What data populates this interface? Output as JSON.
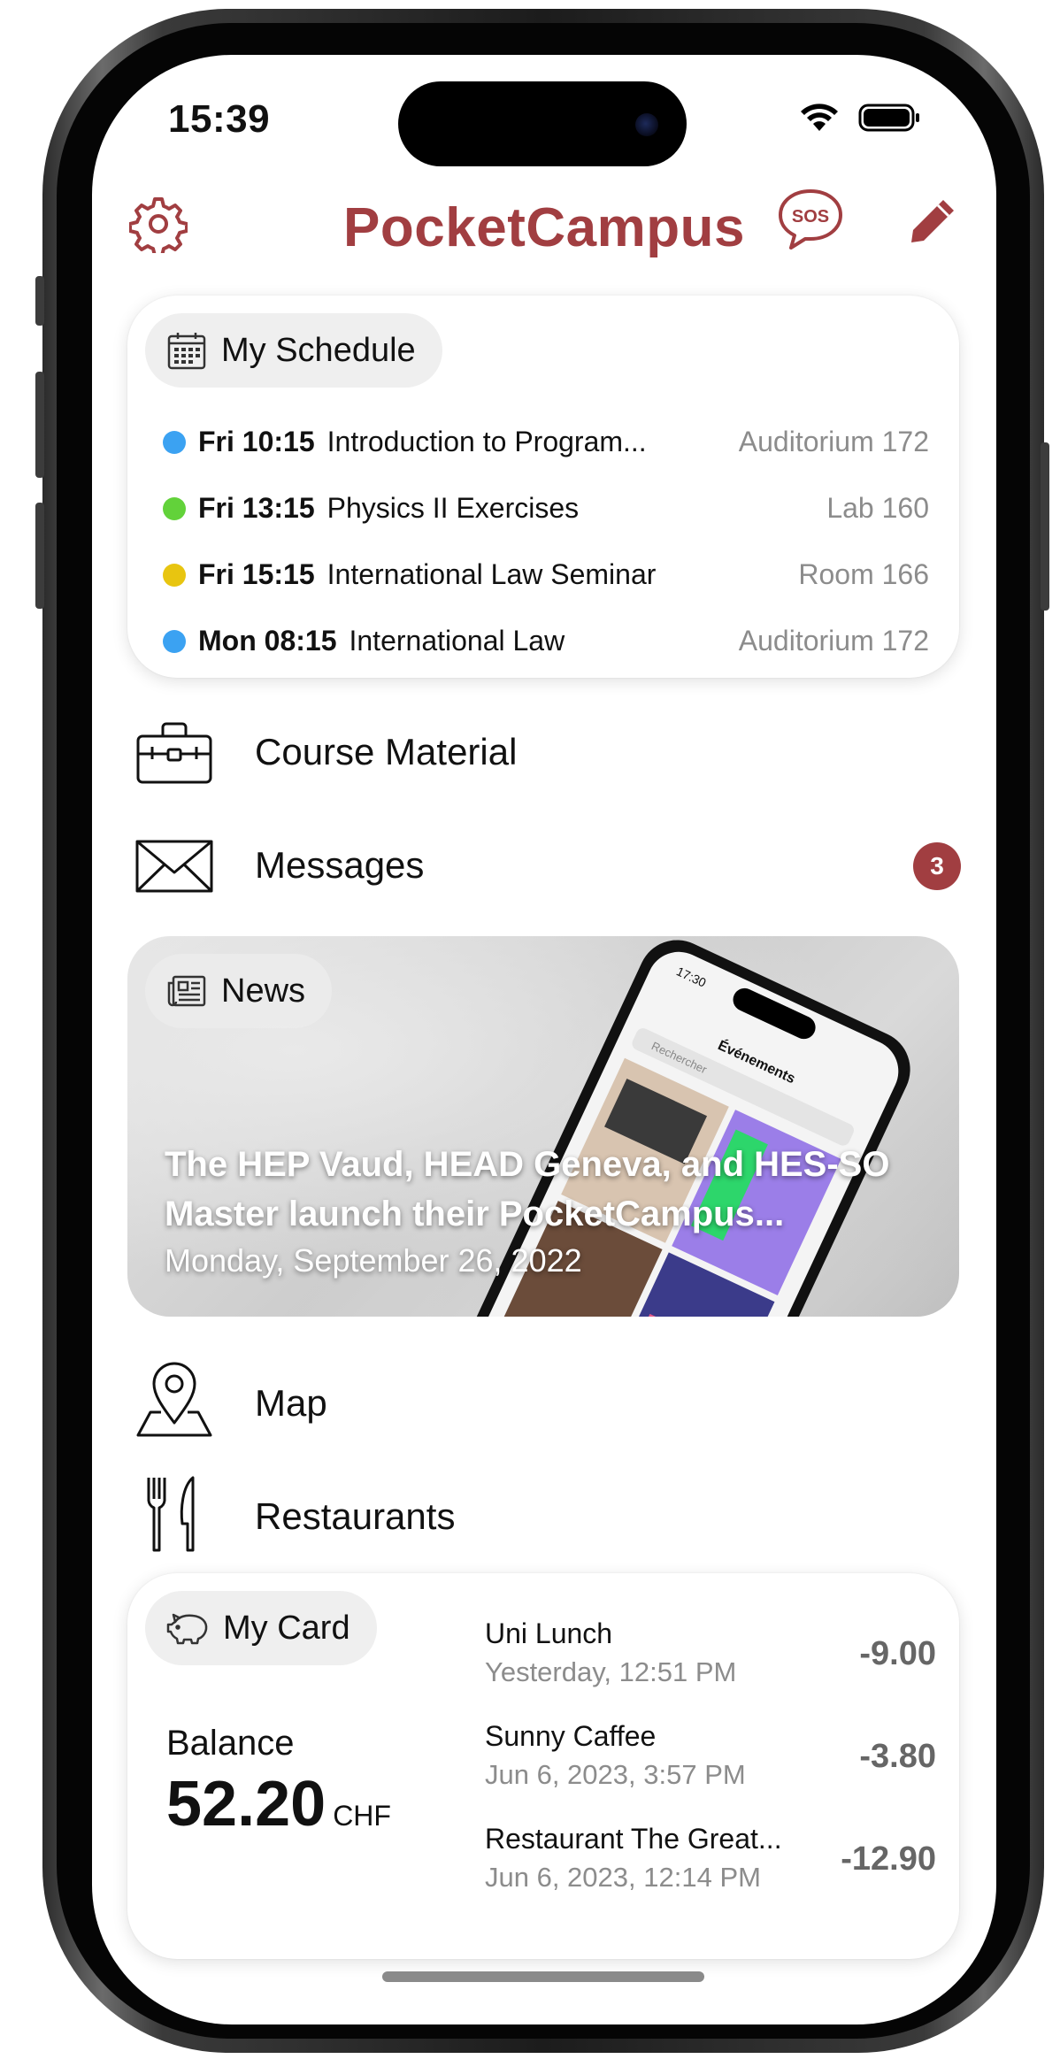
{
  "status_bar": {
    "time": "15:39"
  },
  "header": {
    "title": "PocketCampus",
    "settings_icon": "gear-icon",
    "sos_icon": "sos-icon",
    "sos_label": "SOS",
    "edit_icon": "pencil-icon"
  },
  "schedule": {
    "label": "My Schedule",
    "icon": "calendar-icon",
    "events": [
      {
        "time": "Fri 10:15",
        "title": "Introduction to Program...",
        "room": "Auditorium 172",
        "color": "#3ba2f2"
      },
      {
        "time": "Fri 13:15",
        "title": "Physics II Exercises",
        "room": "Lab 160",
        "color": "#62d23a"
      },
      {
        "time": "Fri 15:15",
        "title": "International Law Seminar",
        "room": "Room 166",
        "color": "#e8c510"
      },
      {
        "time": "Mon 08:15",
        "title": "International Law",
        "room": "Auditorium 172",
        "color": "#3ba2f2"
      }
    ]
  },
  "menu": {
    "course_material": "Course Material",
    "messages": "Messages",
    "messages_badge": "3",
    "map": "Map",
    "restaurants": "Restaurants"
  },
  "news": {
    "label": "News",
    "icon": "newspaper-icon",
    "headline": "The HEP Vaud, HEAD Geneva, and HES-SO Master launch their PocketCampus...",
    "date": "Monday, September 26, 2022",
    "image_phone_time": "17:30",
    "image_screen_title": "Événements",
    "image_search": "Rechercher"
  },
  "mycard": {
    "label": "My Card",
    "icon": "piggy-bank-icon",
    "balance_label": "Balance",
    "balance": "52.20",
    "currency": "CHF",
    "transactions": [
      {
        "name": "Uni Lunch",
        "date": "Yesterday, 12:51 PM",
        "amount": "-9.00"
      },
      {
        "name": "Sunny Caffee",
        "date": "Jun 6, 2023, 3:57 PM",
        "amount": "-3.80"
      },
      {
        "name": "Restaurant The Great...",
        "date": "Jun 6, 2023, 12:14 PM",
        "amount": "-12.90"
      }
    ]
  },
  "colors": {
    "brand": "#a13e41",
    "muted": "#8c8c8c"
  }
}
